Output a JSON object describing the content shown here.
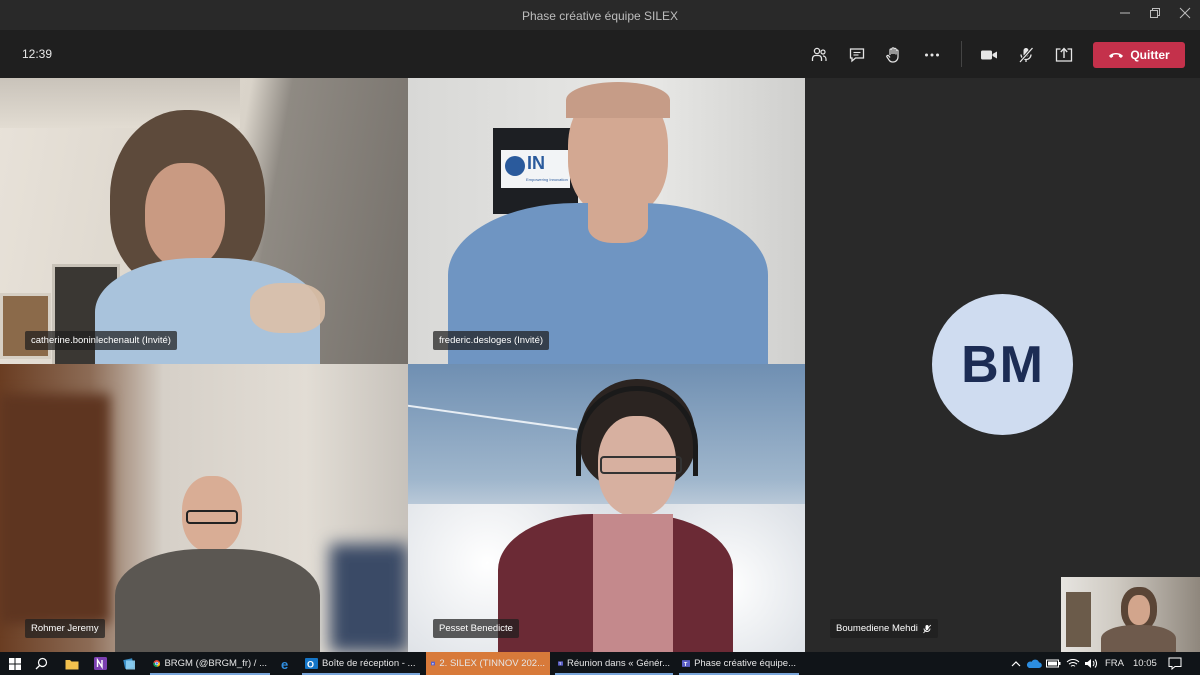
{
  "window": {
    "title": "Phase créative équipe SILEX"
  },
  "toolbar": {
    "time": "12:39",
    "leave_label": "Quitter",
    "icons": [
      "participants-icon",
      "chat-icon",
      "raise-hand-icon",
      "more-icon",
      "camera-icon",
      "mic-muted-icon",
      "share-screen-icon"
    ]
  },
  "participants": [
    {
      "name": "catherine.boninlechenault (Invité)"
    },
    {
      "name": "frederic.desloges (Invité)"
    },
    {
      "name": "Rohmer Jeremy"
    },
    {
      "name": "Pesset Benedicte"
    },
    {
      "name": "Boumediene Mehdi",
      "initials": "BM",
      "muted": true
    }
  ],
  "background_sign": {
    "text": "IN",
    "subtext": "Empowering Innovation"
  },
  "taskbar": {
    "apps": [
      {
        "label": "BRGM (@BRGM_fr) / ..."
      },
      {
        "label": "Boîte de réception - ..."
      },
      {
        "label": "2. SILEX (TINNOV 202...",
        "active": true
      },
      {
        "label": "Réunion dans « Génér..."
      },
      {
        "label": "Phase créative équipe..."
      }
    ],
    "language": "FRA",
    "clock": "10:05"
  },
  "colors": {
    "leave_button": "#c4314b",
    "avatar_bg": "#cfdcf0",
    "avatar_text": "#1c2c54",
    "taskbar_active": "#d87a3a"
  }
}
